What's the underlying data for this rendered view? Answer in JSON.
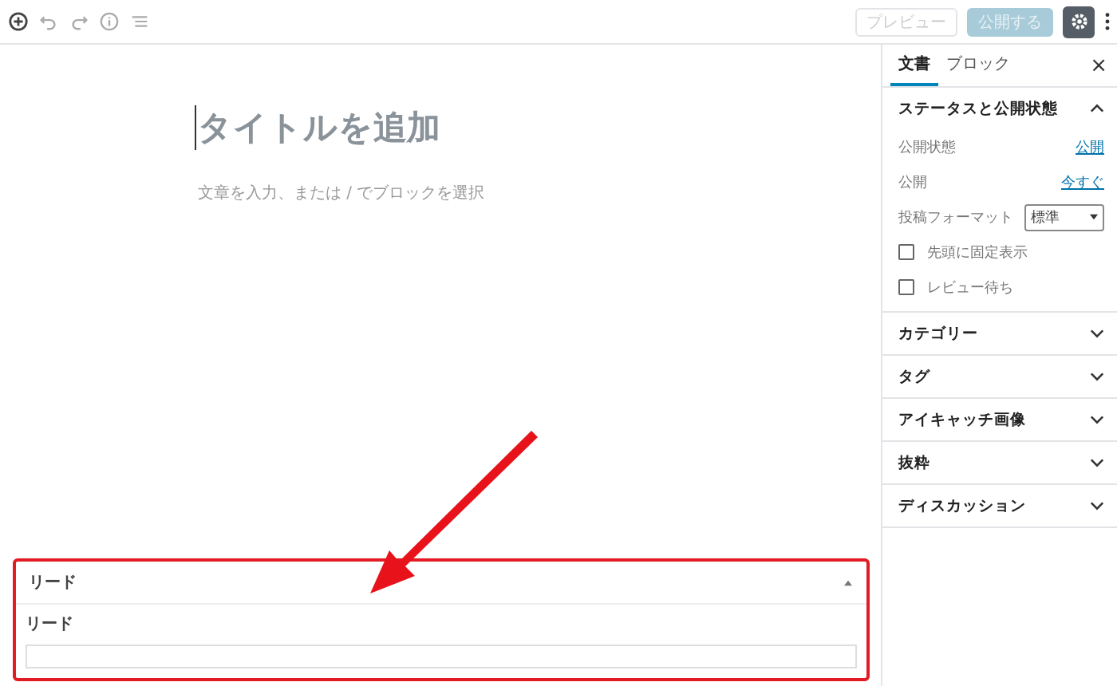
{
  "toolbar": {
    "preview": {
      "label": "プレビュー",
      "disabled": true
    },
    "publish": {
      "label": "公開する",
      "disabled": true
    },
    "settings": {
      "selected": true
    }
  },
  "editor": {
    "title_placeholder": "タイトルを追加",
    "body_placeholder": "文章を入力、または / でブロックを選択"
  },
  "sidebar": {
    "tabs": [
      {
        "label": "文書",
        "selected": true
      },
      {
        "label": "ブロック",
        "selected": false
      }
    ],
    "close": "×",
    "panels": [
      {
        "title": "ステータスと公開状態",
        "expanded": true,
        "rows": [
          {
            "kind": "link",
            "label": "公開状態",
            "value": "公開"
          },
          {
            "kind": "link",
            "label": "公開",
            "value": "今すぐ"
          },
          {
            "kind": "select",
            "label": "投稿フォーマット",
            "value": "標準"
          },
          {
            "kind": "checkbox",
            "label": "先頭に固定表示",
            "checked": false
          },
          {
            "kind": "checkbox",
            "label": "レビュー待ち",
            "checked": false
          }
        ]
      },
      {
        "title": "カテゴリー",
        "expanded": false
      },
      {
        "title": "タグ",
        "expanded": false
      },
      {
        "title": "アイキャッチ画像",
        "expanded": false
      },
      {
        "title": "抜粋",
        "expanded": false
      },
      {
        "title": "ディスカッション",
        "expanded": false
      }
    ]
  },
  "meta_box": {
    "title": "リード",
    "expanded": true,
    "field_label": "リード"
  }
}
